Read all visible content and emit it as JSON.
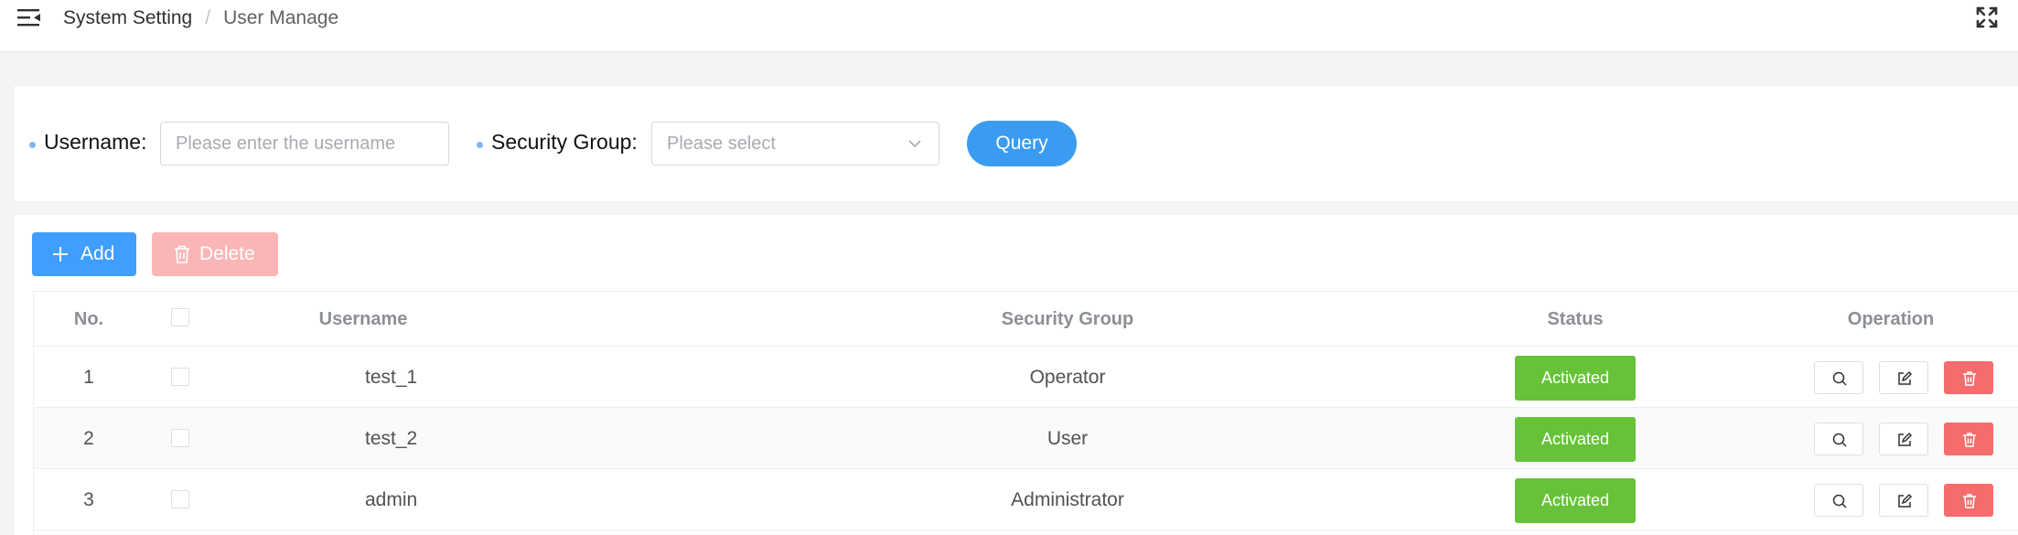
{
  "header": {
    "breadcrumb": [
      "System Setting",
      "User Manage"
    ],
    "separator": "/"
  },
  "search": {
    "username_label": "Username:",
    "username_placeholder": "Please enter the username",
    "username_value": "",
    "group_label": "Security Group:",
    "group_placeholder": "Please select",
    "query_label": "Query"
  },
  "toolbar": {
    "add_label": "Add",
    "delete_label": "Delete"
  },
  "table": {
    "columns": [
      "No.",
      "",
      "Username",
      "Security Group",
      "Status",
      "Operation"
    ],
    "rows": [
      {
        "no": "1",
        "username": "test_1",
        "group": "Operator",
        "status": "Activated"
      },
      {
        "no": "2",
        "username": "test_2",
        "group": "User",
        "status": "Activated"
      },
      {
        "no": "3",
        "username": "admin",
        "group": "Administrator",
        "status": "Activated"
      }
    ]
  },
  "colors": {
    "primary": "#409eff",
    "danger": "#f56c6c",
    "success": "#67c23a"
  },
  "icons": [
    "menu-fold-icon",
    "fullscreen-icon",
    "chevron-down-icon",
    "plus-icon",
    "trash-icon",
    "search-icon",
    "edit-icon",
    "delete-icon"
  ]
}
